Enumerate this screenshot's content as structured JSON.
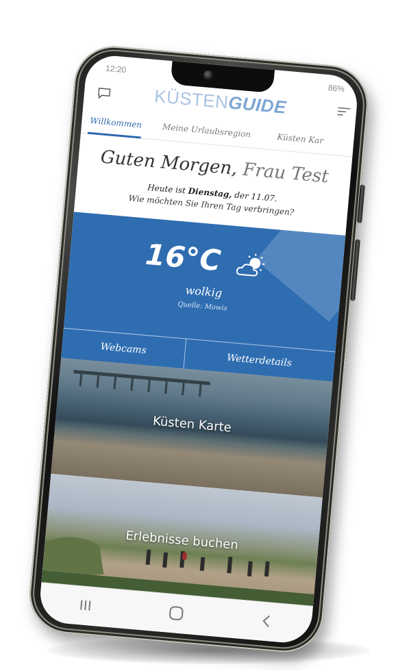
{
  "status": {
    "time": "12:20",
    "battery": "86%"
  },
  "header": {
    "logo_light": "KÜSTEN",
    "logo_bold": "GUIDE",
    "chat_icon": "chat-bubble-icon",
    "menu_icon": "filter-menu-icon"
  },
  "tabs": [
    {
      "label": "Willkommen",
      "active": true
    },
    {
      "label": "Meine Urlaubsregion",
      "active": false
    },
    {
      "label": "Küsten Kar",
      "active": false
    }
  ],
  "greeting": {
    "hello": "Guten Morgen,",
    "name": "Frau Test",
    "date_prefix": "Heute ist",
    "weekday": "Dienstag,",
    "date_suffix": "der 11.07.",
    "question": "Wie möchten Sie Ihren Tag verbringen?"
  },
  "weather": {
    "temperature": "16°C",
    "condition": "wolkig",
    "source": "Quelle: Mowis",
    "icon": "partly-cloudy-icon",
    "color": "#2f6db1"
  },
  "weather_buttons": {
    "webcams": "Webcams",
    "details": "Wetterdetails"
  },
  "cards": [
    {
      "label": "Küsten Karte"
    },
    {
      "label": "Erlebnisse buchen"
    }
  ],
  "navbar": {
    "recent_icon": "recent-apps-icon",
    "home_icon": "home-icon",
    "back_icon": "back-icon"
  }
}
